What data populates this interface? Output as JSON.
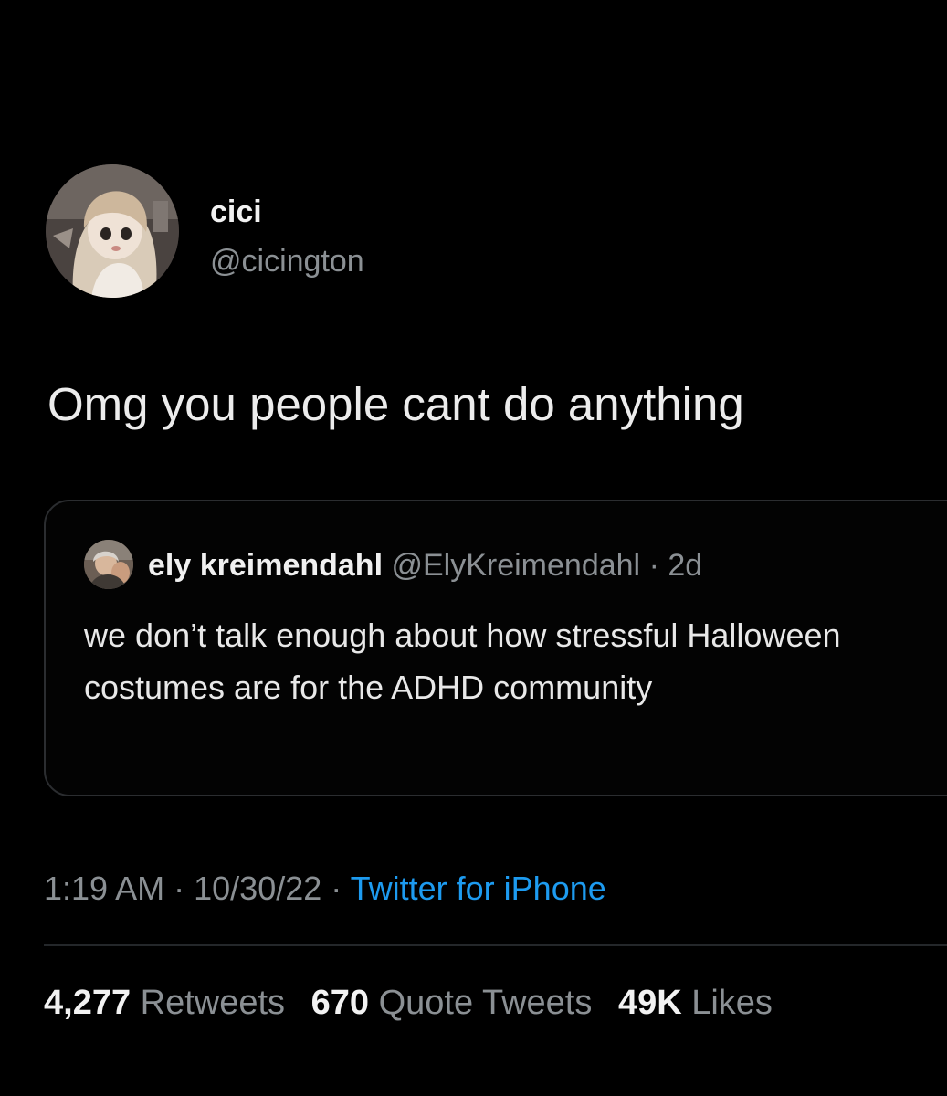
{
  "tweet": {
    "author": {
      "name": "cici",
      "handle": "@cicington"
    },
    "text": "Omg you people cant do anything",
    "quote": {
      "name": "ely kreimendahl",
      "handle": "@ElyKreimendahl",
      "separator": "·",
      "time": "2d",
      "text": "we don’t talk enough about how stressful Halloween costumes are for the ADHD community"
    },
    "meta": {
      "time": "1:19 AM",
      "sep1": "·",
      "date": "10/30/22",
      "sep2": "·",
      "source": "Twitter for iPhone"
    },
    "stats": [
      {
        "count": "4,277",
        "label": "Retweets"
      },
      {
        "count": "670",
        "label": "Quote Tweets"
      },
      {
        "count": "49K",
        "label": "Likes"
      }
    ]
  },
  "colors": {
    "background": "#000000",
    "text_primary": "#e7e9ea",
    "text_secondary": "#8b9094",
    "link": "#1d9bf0",
    "border": "#2b2d30"
  },
  "icons": {
    "author_avatar": "doll-avatar-icon",
    "quote_avatar": "person-avatar-icon"
  }
}
